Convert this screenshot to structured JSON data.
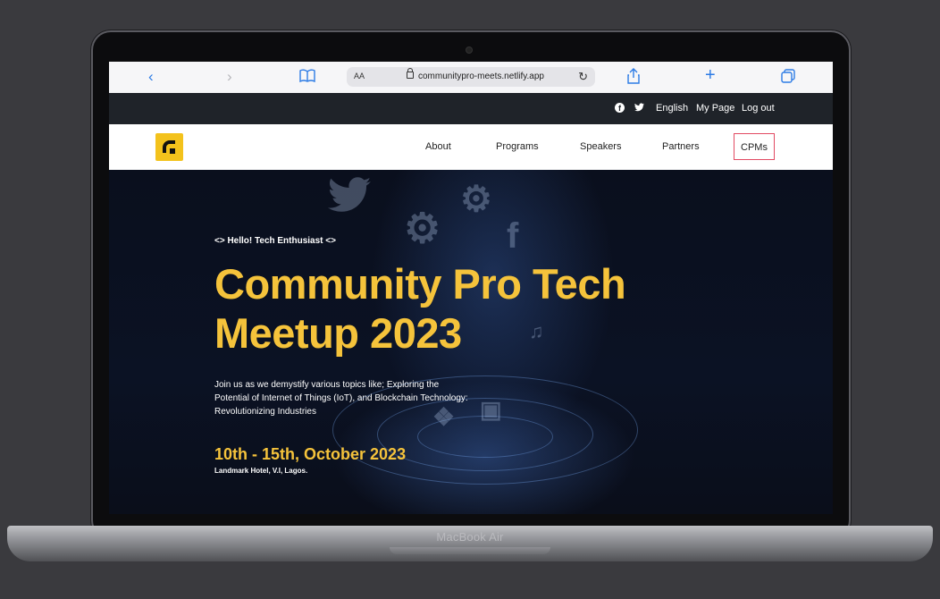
{
  "device": {
    "label": "MacBook Air"
  },
  "browser": {
    "aa_label": "AA",
    "url": "communitypro-meets.netlify.app"
  },
  "topbar": {
    "language": "English",
    "my_page": "My Page",
    "logout": "Log out"
  },
  "nav": {
    "items": [
      {
        "label": "About"
      },
      {
        "label": "Programs"
      },
      {
        "label": "Speakers"
      },
      {
        "label": "Partners"
      },
      {
        "label": "CPMs"
      }
    ]
  },
  "hero": {
    "greeting": "<> Hello! Tech Enthusiast <>",
    "title_line1": "Community Pro Tech",
    "title_line2": "Meetup 2023",
    "description_line1": "Join us as we demystify various topics like; Exploring the",
    "description_line2": "Potential of Internet of Things (IoT), and Blockchain Technology:",
    "description_line3": "Revolutionizing Industries",
    "date": "10th - 15th, October 2023",
    "venue": "Landmark Hotel, V.I, Lagos."
  },
  "colors": {
    "accent": "#f5c33b",
    "link_blue": "#2c7be5",
    "topbar_bg": "#1f2329",
    "highlight_border": "#e24a62"
  }
}
